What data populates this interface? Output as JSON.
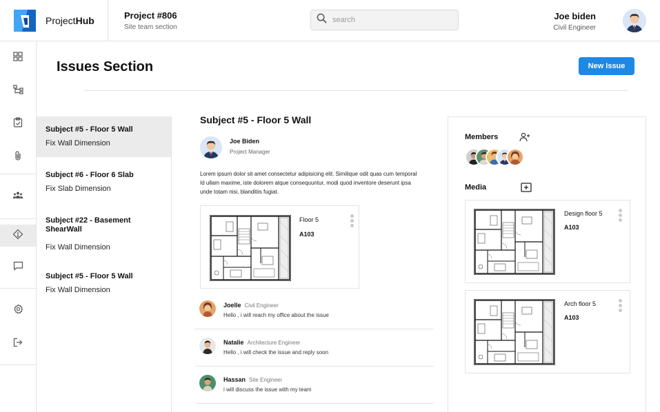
{
  "brand": {
    "name_light": "Project",
    "name_bold": "Hub"
  },
  "project": {
    "title": "Project #806",
    "subtitle": "Site team section"
  },
  "search": {
    "placeholder": "search"
  },
  "user": {
    "name": "Joe biden",
    "role": "Civil Engineer"
  },
  "sidebar": {
    "items": [
      {
        "icon": "dashboard-icon"
      },
      {
        "icon": "hierarchy-icon"
      },
      {
        "icon": "clipboard-check-icon"
      },
      {
        "icon": "paperclip-icon"
      },
      {
        "icon": "team-icon"
      },
      {
        "icon": "issue-diamond-icon",
        "active": true
      },
      {
        "icon": "chat-icon"
      },
      {
        "icon": "settings-icon"
      },
      {
        "icon": "logout-icon"
      }
    ]
  },
  "page": {
    "title": "Issues Section",
    "new_issue_label": "New Issue"
  },
  "issues": [
    {
      "subject": "Subject #5 - Floor 5 Wall",
      "desc": "Fix Wall Dimension"
    },
    {
      "subject": "Subject #6 - Floor 6 Slab",
      "desc": "Fix Slab Dimension"
    },
    {
      "subject": "Subject #22 - Basement ShearWall",
      "desc": "Fix Wall Dimension"
    },
    {
      "subject": "Subject #5 - Floor 5 Wall",
      "desc": "Fix Wall Dimension"
    }
  ],
  "detail": {
    "title": "Subject #5 - Floor 5 Wall",
    "author_name": "Joe Biden",
    "author_role": "Project Manager",
    "body": "Lorem ipsum dolor sit amet consectetur adipisicing elit. Similique odit quas cum temporal Id ullam maxime, iste dolorem atque consequuntur, modi quod inventore deserunt ipsa unde totam nisi, blanditiis fugiat.",
    "attachment": {
      "name": "Floor 5",
      "code": "A103"
    }
  },
  "comments": [
    {
      "name": "Joelle",
      "role": "Civil Engineer",
      "text": "Hello , i will reach my office about the issue"
    },
    {
      "name": "Natalie",
      "role": "Architecture Engineer",
      "text": "Hello ,  i will check the issue and reply soon"
    },
    {
      "name": "Hassan",
      "role": "Site Engineer",
      "text": "i will discuss the issue with my team"
    }
  ],
  "members": {
    "label": "Members"
  },
  "media": {
    "label": "Media",
    "items": [
      {
        "name": "Design floor 5",
        "code": "A103"
      },
      {
        "name": "Arch floor 5",
        "code": "A103"
      }
    ]
  },
  "colors": {
    "accent": "#1e88e5",
    "active_bg": "#ebebeb",
    "border": "#e3e3e3"
  }
}
